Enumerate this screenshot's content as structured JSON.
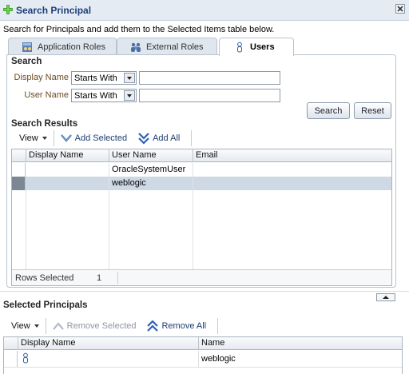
{
  "dialog": {
    "title": "Search Principal",
    "instructions": "Search for Principals and add them to the Selected Items table below."
  },
  "tabs": [
    {
      "label": "Application Roles",
      "icon": "application-roles-icon",
      "selected": false
    },
    {
      "label": "External Roles",
      "icon": "external-roles-icon",
      "selected": false
    },
    {
      "label": "Users",
      "icon": "user-icon",
      "selected": true
    }
  ],
  "search": {
    "heading": "Search",
    "display_name_label": "Display Name",
    "user_name_label": "User Name",
    "display_name_operator": "Starts With",
    "user_name_operator": "Starts With",
    "display_name_value": "",
    "user_name_value": "",
    "search_button": "Search",
    "reset_button": "Reset"
  },
  "results": {
    "heading": "Search Results",
    "toolbar": {
      "view": "View",
      "add_selected": "Add Selected",
      "add_all": "Add All"
    },
    "columns": [
      "Display Name",
      "User Name",
      "Email"
    ],
    "rows": [
      {
        "display_name": "",
        "user_name": "OracleSystemUser",
        "email": "",
        "selected": false
      },
      {
        "display_name": "",
        "user_name": "weblogic",
        "email": "",
        "selected": true
      }
    ],
    "status_label": "Rows Selected",
    "status_value": "1"
  },
  "selected": {
    "heading": "Selected Principals",
    "toolbar": {
      "view": "View",
      "remove_selected": "Remove Selected",
      "remove_all": "Remove All"
    },
    "columns": [
      "Display Name",
      "Name"
    ],
    "rows": [
      {
        "icon": "user-icon",
        "name": "weblogic"
      }
    ]
  },
  "colors": {
    "title_text": "#1c3e7a",
    "label_text": "#6b4c1f",
    "selected_row": "#cfd9e6",
    "row_header_selected": "#7d8794"
  }
}
